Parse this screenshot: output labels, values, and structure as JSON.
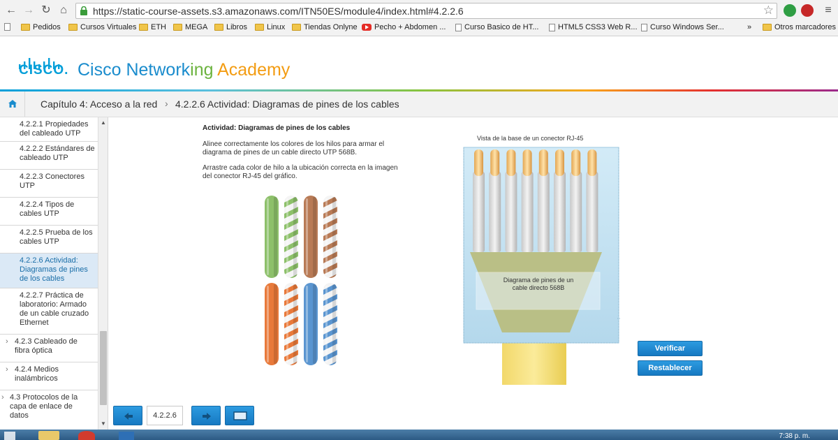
{
  "browser": {
    "url": "https://static-course-assets.s3.amazonaws.com/ITN50ES/module4/index.html#4.2.2.6",
    "bookmarks": [
      {
        "label": "Pedidos",
        "kind": "folder"
      },
      {
        "label": "Cursos Virtuales",
        "kind": "folder"
      },
      {
        "label": "ETH",
        "kind": "folder"
      },
      {
        "label": "MEGA",
        "kind": "folder"
      },
      {
        "label": "Libros",
        "kind": "folder"
      },
      {
        "label": "Linux",
        "kind": "folder"
      },
      {
        "label": "Tiendas Onlyne",
        "kind": "folder"
      },
      {
        "label": "Pecho + Abdomen ...",
        "kind": "youtube"
      },
      {
        "label": "Curso Basico de HT...",
        "kind": "page"
      },
      {
        "label": "HTML5 CSS3 Web R...",
        "kind": "page"
      },
      {
        "label": "Curso Windows Ser...",
        "kind": "page"
      }
    ],
    "overflow": "»",
    "other_bookmarks": "Otros marcadores"
  },
  "brand": {
    "logo_word": "CISCO.",
    "title_blue": "Cisco Network",
    "title_green": "ing ",
    "title_orange": "Academy"
  },
  "breadcrumb": {
    "chapter": "Capítulo 4: Acceso a la red",
    "separator": "›",
    "section": "4.2.2.6 Actividad: Diagramas de pines de los cables"
  },
  "sidebar": {
    "items": [
      {
        "label": "4.2.2.1 Propiedades del cableado UTP",
        "selected": false,
        "chevron": ""
      },
      {
        "label": "4.2.2.2 Estándares de cableado UTP",
        "selected": false,
        "chevron": ""
      },
      {
        "label": "4.2.2.3 Conectores UTP",
        "selected": false,
        "chevron": ""
      },
      {
        "label": "4.2.2.4 Tipos de cables UTP",
        "selected": false,
        "chevron": ""
      },
      {
        "label": "4.2.2.5 Prueba de los cables UTP",
        "selected": false,
        "chevron": ""
      },
      {
        "label": "4.2.2.6 Actividad: Diagramas de pines de los cables",
        "selected": true,
        "chevron": ""
      },
      {
        "label": "4.2.2.7 Práctica de laboratorio: Armado de un cable cruzado Ethernet",
        "selected": false,
        "chevron": ""
      },
      {
        "label": "4.2.3 Cableado de fibra óptica",
        "selected": false,
        "chevron": "›"
      },
      {
        "label": "4.2.4 Medios inalámbricos",
        "selected": false,
        "chevron": "›"
      },
      {
        "label": "4.3 Protocolos de la capa de enlace de datos",
        "selected": false,
        "chevron": "›"
      }
    ]
  },
  "activity": {
    "title": "Actividad: Diagramas de pines de los cables",
    "instruction1": "Alinee correctamente los colores de los hilos para armar el diagrama de pines de un cable directo UTP 568B.",
    "instruction2": "Arrastre cada color de hilo a la ubicación correcta en la imagen del conector RJ-45 del gráfico.",
    "connector_label": "Vista de la base de un conector RJ-45",
    "diagram_label": "Diagrama de pines de un cable directo 568B",
    "wires": [
      {
        "name": "verde",
        "color": "#8dc06a",
        "striped": false
      },
      {
        "name": "blanco-verde",
        "color": "#8dc06a",
        "striped": true
      },
      {
        "name": "marrón",
        "color": "#b87a55",
        "striped": false
      },
      {
        "name": "blanco-marrón",
        "color": "#b87a55",
        "striped": true
      },
      {
        "name": "naranja",
        "color": "#e8793a",
        "striped": false
      },
      {
        "name": "blanco-naranja",
        "color": "#e8793a",
        "striped": true
      },
      {
        "name": "azul",
        "color": "#5a95d0",
        "striped": false
      },
      {
        "name": "blanco-azul",
        "color": "#5a95d0",
        "striped": true
      }
    ],
    "verify_label": "Verificar",
    "reset_label": "Restablecer"
  },
  "nav": {
    "page_number": "4.2.2.6"
  },
  "taskbar": {
    "clock": "7:38 p. m."
  },
  "colors": {
    "accent_blue": "#1a8ccd",
    "button_blue": "#1679c2",
    "selected_bg": "#dbe9f6"
  }
}
